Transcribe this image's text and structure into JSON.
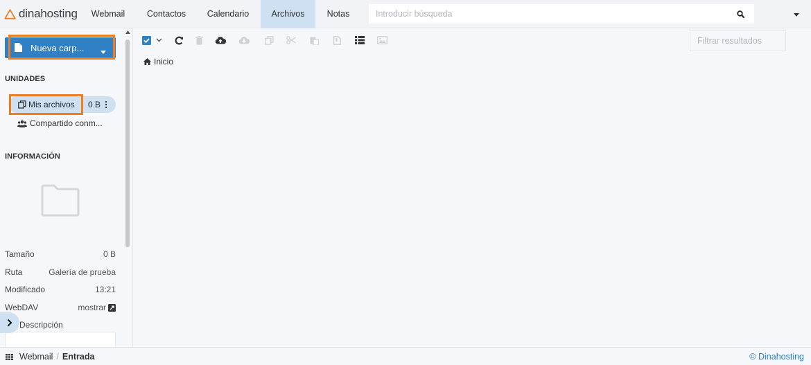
{
  "brand": {
    "name": "dinahosting",
    "color": "#ef7d22"
  },
  "nav": {
    "items": [
      {
        "label": "Webmail",
        "active": false
      },
      {
        "label": "Contactos",
        "active": false
      },
      {
        "label": "Calendario",
        "active": false
      },
      {
        "label": "Archivos",
        "active": true
      },
      {
        "label": "Notas",
        "active": false
      }
    ]
  },
  "search": {
    "placeholder": "Introducir búsqueda",
    "icon": "search-icon"
  },
  "sidebar": {
    "new_button": {
      "label": "Nueva carp...",
      "icon": "document-icon"
    },
    "units_title": "UNIDADES",
    "units": [
      {
        "label": "Mis archivos",
        "size": "0 B",
        "icon": "copy-icon",
        "selected": true
      },
      {
        "label": "Compartido conm...",
        "icon": "users-icon"
      }
    ],
    "info_title": "INFORMACIÓN",
    "info": {
      "size_label": "Tamaño",
      "size_value": "0 B",
      "path_label": "Ruta",
      "path_value": "Galería de prueba",
      "modified_label": "Modificado",
      "modified_value": "13:21",
      "webdav_label": "WebDAV",
      "webdav_value": "mostrar",
      "description_label": "Descripción"
    }
  },
  "toolbar": {
    "icons": [
      "select-all-checkbox-icon",
      "chevron-down-icon",
      "refresh-icon",
      "trash-icon",
      "upload-icon",
      "download-icon",
      "copy-icon",
      "cut-icon",
      "paste-icon",
      "archive-icon",
      "list-view-icon",
      "image-view-icon"
    ]
  },
  "filter": {
    "placeholder": "Filtrar resultados"
  },
  "breadcrumb": {
    "home": "Inicio"
  },
  "footer": {
    "app": "Webmail",
    "separator": "/",
    "current": "Entrada",
    "copyright": "© Dinahosting"
  },
  "colors": {
    "accent": "#2f80c4",
    "active_tab": "#cfe0f3",
    "highlight": "#ef7d22"
  }
}
